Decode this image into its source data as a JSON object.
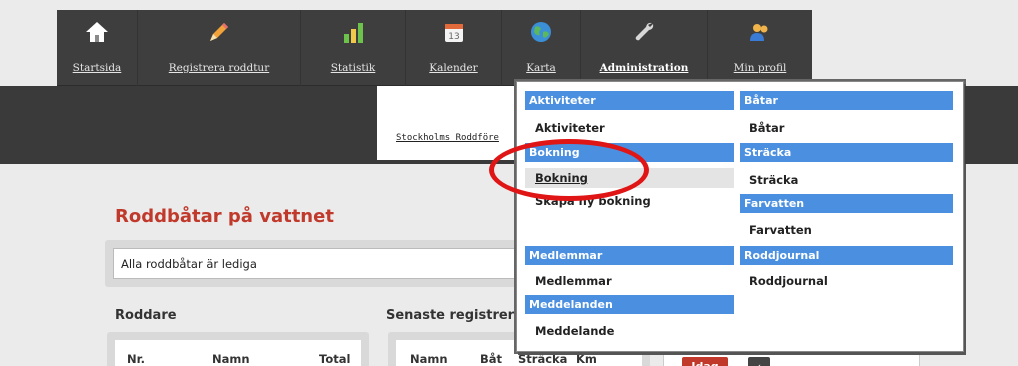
{
  "nav": {
    "items": [
      {
        "label": "Startsida",
        "icon": "home-icon"
      },
      {
        "label": "Registrera roddtur",
        "icon": "pencil-icon"
      },
      {
        "label": "Statistik",
        "icon": "bar-chart-icon"
      },
      {
        "label": "Kalender",
        "icon": "calendar-icon"
      },
      {
        "label": "Karta",
        "icon": "globe-icon"
      },
      {
        "label": "Administration",
        "icon": "wrench-icon"
      },
      {
        "label": "Min profil",
        "icon": "user-icon"
      }
    ],
    "active": "Administration",
    "calendar_day": "13"
  },
  "banner": {
    "link_text": "Stockholms Roddföre"
  },
  "main": {
    "title": "Roddbåtar på vattnet",
    "status": "Alla roddbåtar är lediga",
    "rowers": {
      "title": "Roddare",
      "columns": [
        "Nr.",
        "Namn",
        "Total"
      ]
    },
    "latest": {
      "title": "Senaste registrer",
      "columns": [
        "Namn",
        "Båt",
        "Sträcka",
        "Km"
      ]
    },
    "today_button": "Idag",
    "nav_button": "‹"
  },
  "dropdown": {
    "left": [
      {
        "header": "Aktiviteter",
        "items": [
          "Aktiviteter"
        ]
      },
      {
        "header": "Bokning",
        "items": [
          "Bokning",
          "Skapa ny bokning"
        ]
      },
      {
        "header": "Medlemmar",
        "items": [
          "Medlemmar"
        ]
      },
      {
        "header": "Meddelanden",
        "items": [
          "Meddelande"
        ]
      }
    ],
    "right": [
      {
        "header": "Båtar",
        "items": [
          "Båtar"
        ]
      },
      {
        "header": "Sträcka",
        "items": [
          "Sträcka"
        ]
      },
      {
        "header": "Farvatten",
        "items": [
          "Farvatten"
        ]
      },
      {
        "header": "Roddjournal",
        "items": [
          "Roddjournal"
        ]
      }
    ]
  },
  "colors": {
    "accent": "#c0392b",
    "menu_header": "#4a8fe0",
    "nav_bg": "#3e3e3e",
    "highlight_ring": "#e01515"
  }
}
